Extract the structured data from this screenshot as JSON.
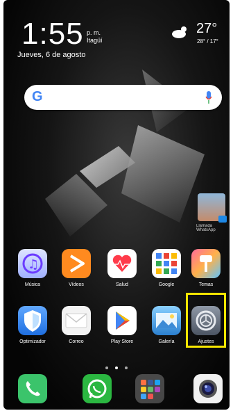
{
  "status": {
    "time": "1:55",
    "ampm": "p. m.",
    "location": "Itagüí",
    "date": "Jueves, 6 de agosto",
    "temperature": "27°",
    "temp_range": "28° / 17°"
  },
  "search": {
    "logo": "G"
  },
  "contact": {
    "label": "Llamada WhatsApp"
  },
  "row1": [
    {
      "label": "Música",
      "icon": "music-icon"
    },
    {
      "label": "Vídeos",
      "icon": "video-play-icon"
    },
    {
      "label": "Salud",
      "icon": "heart-pulse-icon"
    },
    {
      "label": "Google",
      "icon": "google-folder-icon"
    },
    {
      "label": "Temas",
      "icon": "paintbrush-icon"
    }
  ],
  "row2": [
    {
      "label": "Optimizador",
      "icon": "shield-icon"
    },
    {
      "label": "Correo",
      "icon": "mail-icon"
    },
    {
      "label": "Play Store",
      "icon": "play-store-icon"
    },
    {
      "label": "Galería",
      "icon": "gallery-icon"
    },
    {
      "label": "Ajustes",
      "icon": "settings-gear-icon"
    }
  ],
  "dock": [
    {
      "icon": "phone-icon"
    },
    {
      "icon": "whatsapp-icon"
    },
    {
      "icon": "apps-folder-icon"
    },
    {
      "icon": "camera-icon"
    }
  ],
  "colors": {
    "highlight": "#f6e600"
  }
}
